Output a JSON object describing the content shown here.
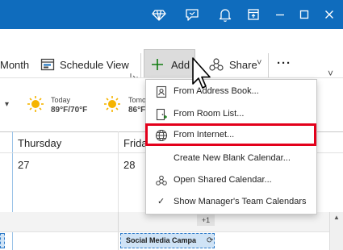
{
  "ribbon": {
    "month_label": "Month",
    "schedule_view_label": "Schedule View",
    "add_label": "Add",
    "share_label": "Share",
    "share_chevron": "˅",
    "more_label": "···",
    "expand_icon": "corner-expand-icon",
    "collapse_chevron": "˅"
  },
  "weather": [
    {
      "day": "Today",
      "temps": "89°F/70°F",
      "icon": "sun-icon"
    },
    {
      "day": "Tomo",
      "temps": "86°F",
      "icon": "sun-icon"
    }
  ],
  "calendar": {
    "days": [
      {
        "name": "Thursday",
        "date": "27"
      },
      {
        "name": "Frida",
        "date": "28"
      }
    ],
    "more_count": "+1",
    "event_title": "Social Media Campa"
  },
  "menu": {
    "items": [
      {
        "label": "From Address Book...",
        "icon": "address-book-icon"
      },
      {
        "label": "From Room List...",
        "icon": "room-list-icon"
      },
      {
        "label": "From Internet...",
        "icon": "globe-icon"
      },
      {
        "label": "Create New Blank Calendar...",
        "icon": ""
      },
      {
        "label": "Open Shared Calendar...",
        "icon": "shared-calendar-icon"
      },
      {
        "label": "Show Manager's Team Calendars",
        "icon": "checkmark-icon",
        "check": "✓"
      }
    ]
  },
  "colors": {
    "titlebar": "#0f6cbd",
    "add_button_bg": "#dcdcdc",
    "highlight": "#e3001b",
    "event_bg": "#cfe3f6",
    "sun": "#f5b400"
  }
}
